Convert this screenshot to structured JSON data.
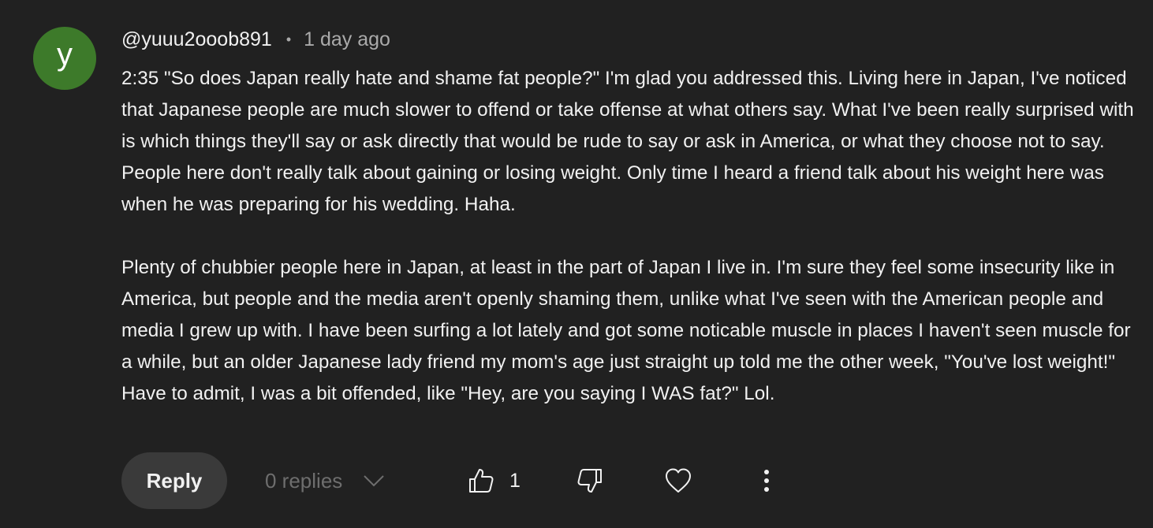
{
  "comment": {
    "avatar_letter": "y",
    "avatar_color": "#3d7a2a",
    "username": "@yuuu2ooob891",
    "separator": "•",
    "timestamp": "1 day ago",
    "paragraphs": [
      "2:35 \"So does Japan really hate and shame fat people?\" I'm glad you addressed this. Living here in Japan, I've noticed that Japanese people are much slower to offend or take offense at what others say. What I've been really surprised with is which things they'll say or ask directly that would be rude to say or ask in America, or what they choose not to say. People here don't really talk about gaining or losing weight. Only time I heard a friend talk about his weight here was when he was preparing for his wedding. Haha.",
      "Plenty of chubbier people here in Japan, at least in the part of Japan I live in. I'm sure they feel some insecurity like in America, but people and the media aren't openly shaming them, unlike what I've seen with the American people and media I grew up with. I have been surfing a lot lately and got some noticable muscle in places I haven't seen muscle for a while, but an older Japanese lady friend my mom's age just straight up told me the other week, \"You've lost weight!\" Have to admit, I was a bit offended, like \"Hey, are you saying I WAS fat?\" Lol."
    ]
  },
  "actions": {
    "reply_label": "Reply",
    "replies_label": "0 replies",
    "replies_icon": "chevron-down-icon",
    "like_icon": "thumbs-up-icon",
    "like_count": "1",
    "dislike_icon": "thumbs-down-icon",
    "heart_icon": "heart-icon",
    "more_icon": "more-vertical-icon"
  }
}
